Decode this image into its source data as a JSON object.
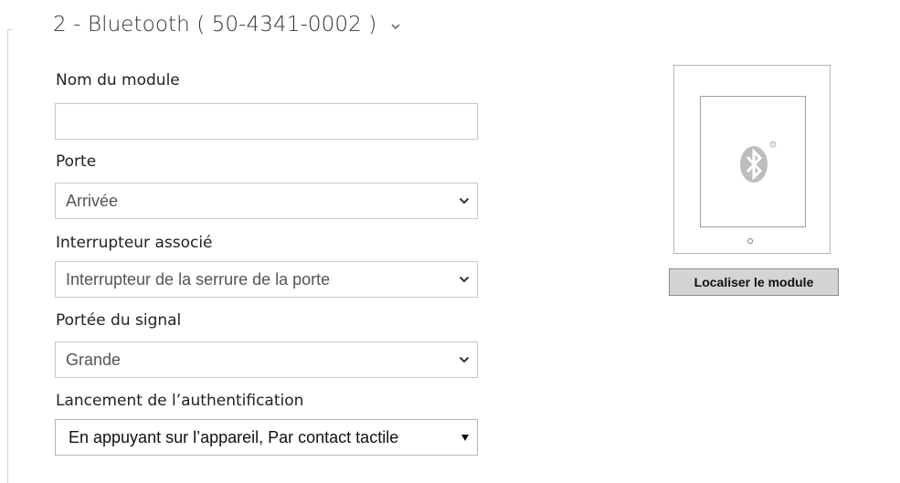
{
  "module": {
    "title": "2 - Bluetooth ( 50-4341-0002 )",
    "expand_icon": "chevron-down-icon"
  },
  "form": {
    "module_name": {
      "label": "Nom du module",
      "value": ""
    },
    "door": {
      "label": "Porte",
      "value": "Arrivée"
    },
    "associated_switch": {
      "label": "Interrupteur associé",
      "value": "Interrupteur de la serrure de la porte"
    },
    "signal_range": {
      "label": "Portée du signal",
      "value": "Grande"
    },
    "auth_trigger": {
      "label": "Lancement de l’authentification",
      "value": "En appuyant sur l’appareil, Par contact tactile"
    }
  },
  "device_preview": {
    "icon": "bluetooth-icon",
    "registered_mark": "®",
    "locate_button": "Localiser le module"
  },
  "colors": {
    "border": "#c8c8c8",
    "bluetooth_badge": "#bdbdbd",
    "button_bg": "#d4d4d4"
  }
}
